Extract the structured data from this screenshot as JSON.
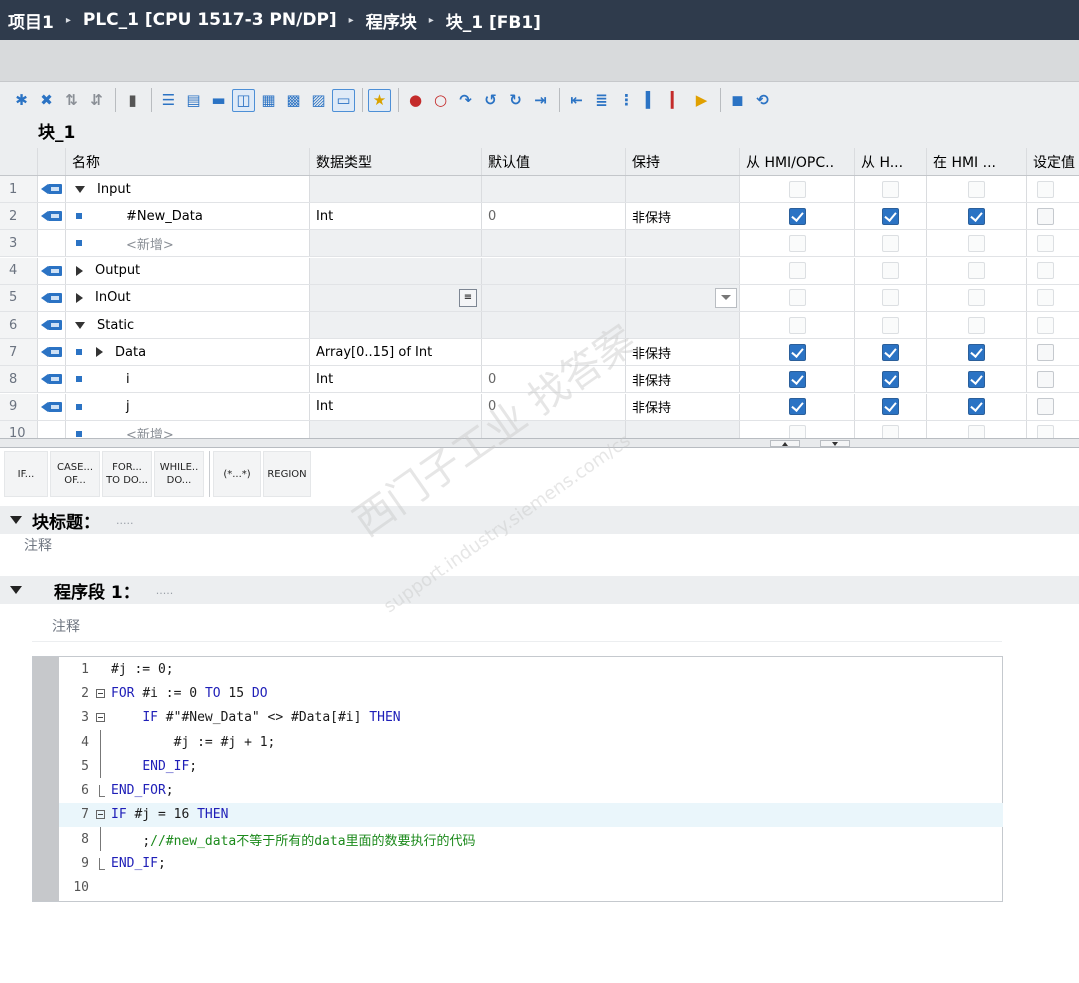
{
  "breadcrumb": {
    "items": [
      "项目1",
      "PLC_1 [CPU 1517-3 PN/DP]",
      "程序块",
      "块_1 [FB1]"
    ],
    "separator": "▸"
  },
  "block": {
    "name": "块_1"
  },
  "toolbar": {
    "icons": [
      "insert-row-icon",
      "delete-row-icon",
      "copy-icon",
      "paste-icon",
      "monitor-icon",
      "indent-icon",
      "outdent-icon",
      "list-icon",
      "comment-icon",
      "net-expand-icon",
      "net-collapse-icon",
      "abs-icon",
      "single-line-icon",
      "favorites-icon",
      "breakpoint-icon",
      "breakpoint-clear-icon",
      "step-icon",
      "step-over-icon",
      "step-out-icon",
      "goto-icon",
      "line-indent-icon",
      "line-outdent-icon",
      "align-icon",
      "bookmark-icon",
      "bookmark-next-icon",
      "start-icon",
      "stop-icon",
      "reset-icon"
    ]
  },
  "interface": {
    "headers": [
      "名称",
      "数据类型",
      "默认值",
      "保持",
      "从 HMI/OPC..",
      "从 H...",
      "在 HMI ...",
      "设定值"
    ],
    "rows": [
      {
        "num": "1",
        "name": "Input",
        "type": "",
        "default": "",
        "retain": "",
        "hmi": [
          false,
          false,
          false
        ],
        "kind": "section-open"
      },
      {
        "num": "2",
        "name": "#New_Data",
        "type": "Int",
        "default": "0",
        "retain": "非保持",
        "hmi": [
          true,
          true,
          true
        ],
        "kind": "var"
      },
      {
        "num": "3",
        "name": "<新增>",
        "type": "",
        "default": "",
        "retain": "",
        "hmi": [
          false,
          false,
          false
        ],
        "kind": "new"
      },
      {
        "num": "4",
        "name": "Output",
        "type": "",
        "default": "",
        "retain": "",
        "hmi": [
          false,
          false,
          false
        ],
        "kind": "section-closed"
      },
      {
        "num": "5",
        "name": "InOut",
        "type": "",
        "default": "",
        "retain": "",
        "hmi": [
          false,
          false,
          false
        ],
        "kind": "section-closed"
      },
      {
        "num": "6",
        "name": "Static",
        "type": "",
        "default": "",
        "retain": "",
        "hmi": [
          false,
          false,
          false
        ],
        "kind": "section-open"
      },
      {
        "num": "7",
        "name": "Data",
        "type": "Array[0..15] of Int",
        "default": "",
        "retain": "非保持",
        "hmi": [
          true,
          true,
          true
        ],
        "kind": "array"
      },
      {
        "num": "8",
        "name": "i",
        "type": "Int",
        "default": "0",
        "retain": "非保持",
        "hmi": [
          true,
          true,
          true
        ],
        "kind": "var"
      },
      {
        "num": "9",
        "name": "j",
        "type": "Int",
        "default": "0",
        "retain": "非保持",
        "hmi": [
          true,
          true,
          true
        ],
        "kind": "var"
      },
      {
        "num": "10",
        "name": "<新增>",
        "type": "",
        "default": "",
        "retain": "",
        "hmi": [
          false,
          false,
          false
        ],
        "kind": "new"
      }
    ]
  },
  "scl_buttons": [
    {
      "line1": "IF...",
      "line2": ""
    },
    {
      "line1": "CASE...",
      "line2": "OF..."
    },
    {
      "line1": "FOR...",
      "line2": "TO DO..."
    },
    {
      "line1": "WHILE..",
      "line2": "DO..."
    },
    {
      "line1": "(*...*)",
      "line2": ""
    },
    {
      "line1": "REGION",
      "line2": ""
    }
  ],
  "block_title": {
    "label": "块标题：",
    "dots": ".....",
    "comment": "注释"
  },
  "segment": {
    "label": "程序段 1：",
    "dots": ".....",
    "comment": "注释"
  },
  "code": [
    {
      "n": "1",
      "fold": "",
      "indent": "",
      "parts": [
        [
          "txt",
          "#j := 0;"
        ]
      ]
    },
    {
      "n": "2",
      "fold": "box",
      "indent": "",
      "parts": [
        [
          "kw",
          "FOR "
        ],
        [
          "txt",
          "#i := 0 "
        ],
        [
          "kw",
          "TO"
        ],
        [
          "txt",
          " 15 "
        ],
        [
          "kw",
          "DO"
        ]
      ]
    },
    {
      "n": "3",
      "fold": "box",
      "indent": "    ",
      "parts": [
        [
          "kw",
          "IF "
        ],
        [
          "txt",
          "#\"#New_Data\" <> #Data[#i] "
        ],
        [
          "kw",
          "THEN"
        ]
      ]
    },
    {
      "n": "4",
      "fold": "line",
      "indent": "        ",
      "parts": [
        [
          "txt",
          "#j := #j + 1;"
        ]
      ]
    },
    {
      "n": "5",
      "fold": "line",
      "indent": "    ",
      "parts": [
        [
          "kw",
          "END_IF"
        ],
        [
          "txt",
          ";"
        ]
      ]
    },
    {
      "n": "6",
      "fold": "end",
      "indent": "",
      "parts": [
        [
          "kw",
          "END_FOR"
        ],
        [
          "txt",
          ";"
        ]
      ]
    },
    {
      "n": "7",
      "fold": "box",
      "indent": "",
      "parts": [
        [
          "kw",
          "IF "
        ],
        [
          "txt",
          "#j = 16 "
        ],
        [
          "kw",
          "THEN"
        ]
      ],
      "highlight": true
    },
    {
      "n": "8",
      "fold": "line",
      "indent": "    ",
      "parts": [
        [
          "txt",
          ";"
        ],
        [
          "cmt",
          "//#new_data不等于所有的data里面的数要执行的代码"
        ]
      ]
    },
    {
      "n": "9",
      "fold": "end",
      "indent": "",
      "parts": [
        [
          "kw",
          "END_IF"
        ],
        [
          "txt",
          ";"
        ]
      ]
    },
    {
      "n": "10",
      "fold": "",
      "indent": "",
      "parts": []
    }
  ],
  "watermark": {
    "line1": "西门子工业  找答案",
    "line2": "support.industry.siemens.com/cs"
  },
  "colors": {
    "titlebar": "#2f3b4c",
    "accent": "#2b73c4",
    "keyword": "#1f1fb8",
    "comment": "#1c8a1c"
  }
}
